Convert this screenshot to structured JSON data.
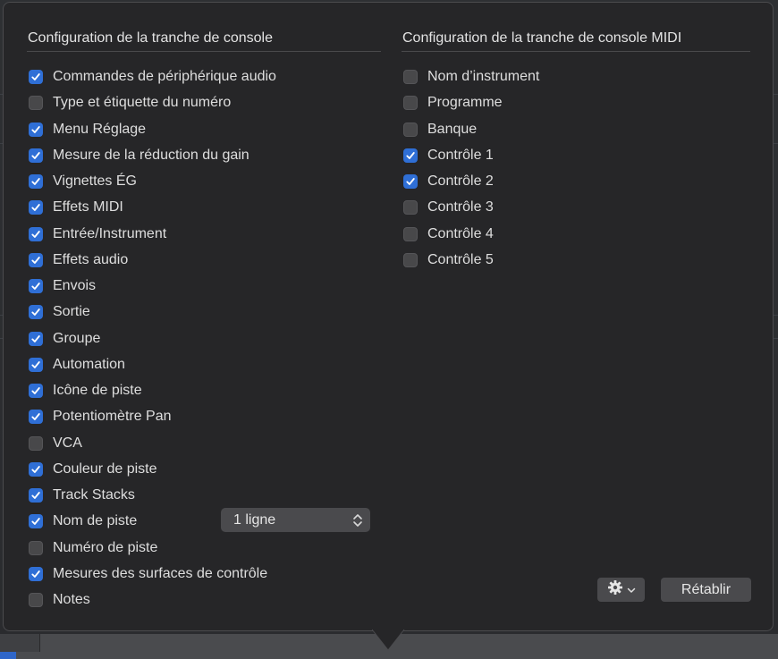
{
  "left": {
    "title": "Configuration de la tranche de console",
    "items": [
      {
        "label": "Commandes de périphérique audio",
        "checked": true
      },
      {
        "label": "Type et étiquette du numéro",
        "checked": false
      },
      {
        "label": "Menu Réglage",
        "checked": true
      },
      {
        "label": "Mesure de la réduction du gain",
        "checked": true
      },
      {
        "label": "Vignettes ÉG",
        "checked": true
      },
      {
        "label": "Effets MIDI",
        "checked": true
      },
      {
        "label": "Entrée/Instrument",
        "checked": true
      },
      {
        "label": "Effets audio",
        "checked": true
      },
      {
        "label": "Envois",
        "checked": true
      },
      {
        "label": "Sortie",
        "checked": true
      },
      {
        "label": "Groupe",
        "checked": true
      },
      {
        "label": "Automation",
        "checked": true
      },
      {
        "label": "Icône de piste",
        "checked": true
      },
      {
        "label": "Potentiomètre Pan",
        "checked": true
      },
      {
        "label": "VCA",
        "checked": false
      },
      {
        "label": "Couleur de piste",
        "checked": true
      },
      {
        "label": "Track Stacks",
        "checked": true
      },
      {
        "label": "Nom de piste",
        "checked": true
      },
      {
        "label": "Numéro de piste",
        "checked": false
      },
      {
        "label": "Mesures des surfaces de contrôle",
        "checked": true
      },
      {
        "label": "Notes",
        "checked": false
      }
    ],
    "track_name_lines": "1 ligne"
  },
  "right": {
    "title": "Configuration de la tranche de console MIDI",
    "items": [
      {
        "label": "Nom d’instrument",
        "checked": false
      },
      {
        "label": "Programme",
        "checked": false
      },
      {
        "label": "Banque",
        "checked": false
      },
      {
        "label": "Contrôle 1",
        "checked": true
      },
      {
        "label": "Contrôle 2",
        "checked": true
      },
      {
        "label": "Contrôle 3",
        "checked": false
      },
      {
        "label": "Contrôle 4",
        "checked": false
      },
      {
        "label": "Contrôle 5",
        "checked": false
      }
    ]
  },
  "footer": {
    "gear_icon": "gear-icon",
    "reset_label": "Rétablir"
  },
  "colors": {
    "checkbox_on": "#2f6fd6",
    "panel_bg": "#262628"
  }
}
